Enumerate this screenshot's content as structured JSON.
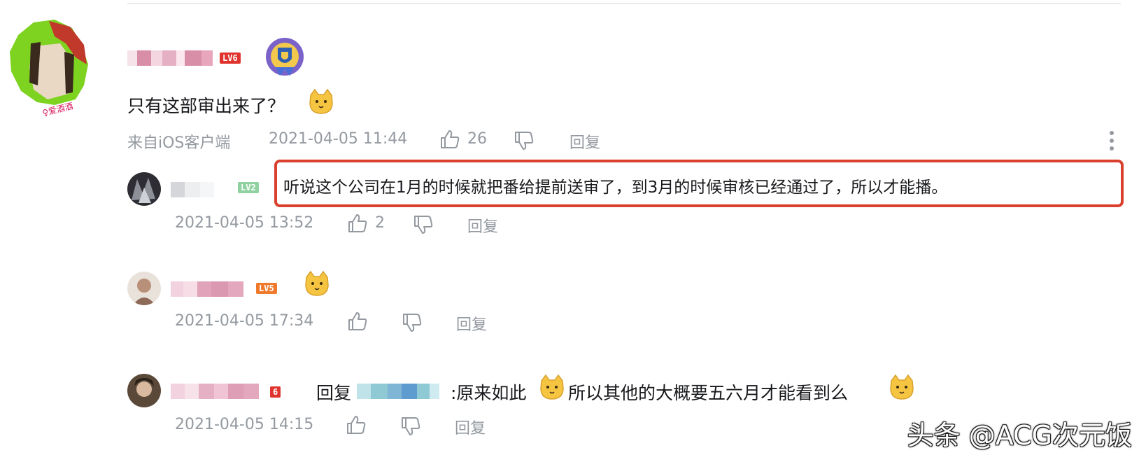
{
  "comment": {
    "text": "只有这部审出来了？",
    "source": "来自iOS客户端",
    "time": "2021-04-05 11:44",
    "likes": "26",
    "reply_label": "回复",
    "level": "LV6"
  },
  "replies": [
    {
      "level": "LV2",
      "text": "听说这个公司在1月的时候就把番给提前送审了，到3月的时候审核已经通过了，所以才能播。",
      "time": "2021-04-05 13:52",
      "likes": "2",
      "reply_label": "回复"
    },
    {
      "level": "LV5",
      "text": "",
      "time": "2021-04-05 17:34",
      "likes": "",
      "reply_label": "回复"
    },
    {
      "level": "6",
      "reply_prefix": "回复",
      "text_a": ":原来如此",
      "text_b": "所以其他的大概要五六月才能看到么",
      "time": "2021-04-05 14:15",
      "likes": "",
      "reply_label": "回复"
    }
  ],
  "watermark": "头条 @ACG次元饭",
  "colors": {
    "highlight": "#d9412e",
    "meta": "#9499a0",
    "level_red": "#e0332e",
    "level_orange": "#f07a2c",
    "level_green": "#8fd1a0"
  },
  "icons": [
    "thumbs-up-icon",
    "thumbs-down-icon",
    "more-vertical-icon",
    "cat-emoji-icon",
    "medal-badge-icon"
  ]
}
